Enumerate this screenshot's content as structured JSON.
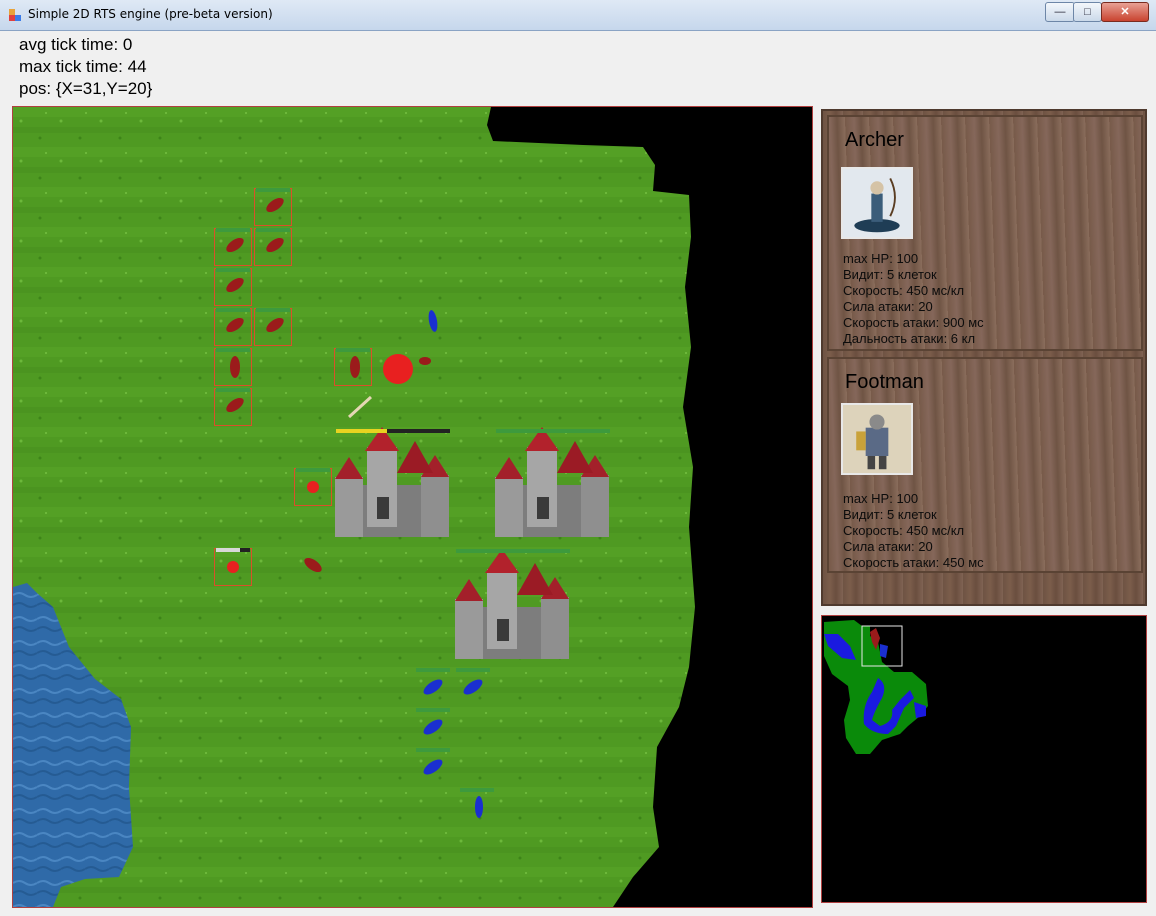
{
  "window": {
    "title": "Simple 2D RTS engine (pre-beta version)",
    "btn_min": "—",
    "btn_max": "□",
    "btn_close": "✕"
  },
  "stats": {
    "avg_tick": "avg tick time: 0",
    "max_tick": "max tick time: 44",
    "pos": "pos: {X=31,Y=20}"
  },
  "units": [
    {
      "name": "Archer",
      "stats": [
        "max HP: 100",
        "Видит: 5 клеток",
        "Скорость: 450 мс/кл",
        "Сила атаки: 20",
        "Скорость атаки: 900 мс",
        "Дальность атаки: 6 кл"
      ]
    },
    {
      "name": "Footman",
      "stats": [
        "max HP: 100",
        "Видит: 5 клеток",
        "Скорость: 450 мс/кл",
        "Сила атаки: 20",
        "Скорость атаки: 450 мс"
      ]
    }
  ],
  "colors": {
    "grass": "#4f9a22",
    "water": "#2f6aa8",
    "void": "#000000",
    "selection": "#d9502a",
    "hp_bar": "#3d9a3d",
    "team_red": "#9b1b1b",
    "team_blue": "#1a2fd0",
    "minimap_grass": "#0a8a0a",
    "minimap_water": "#1a1ae0"
  }
}
